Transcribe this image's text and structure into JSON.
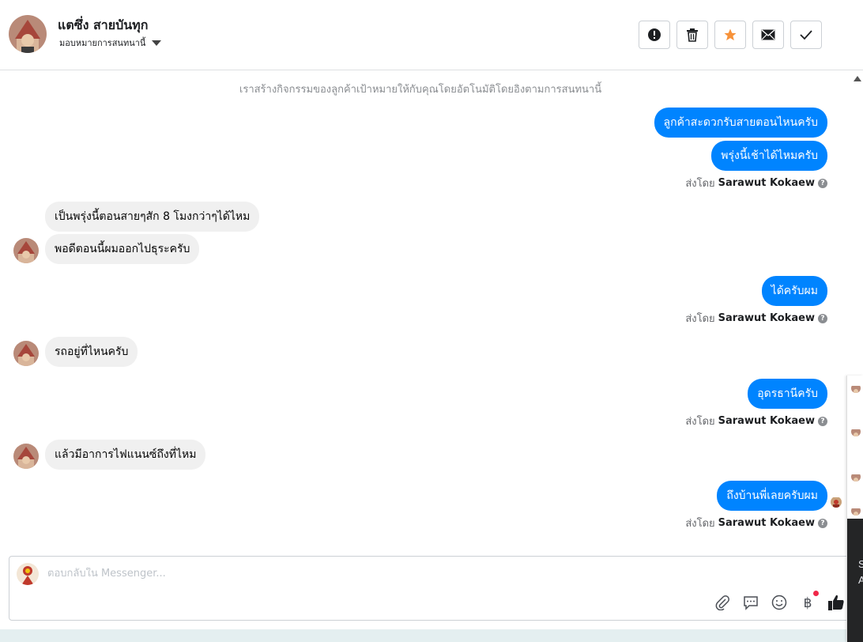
{
  "header": {
    "customer_name": "แตซึ่ง สายบันทุก",
    "assign_label": "มอบหมายการสนทนานี้",
    "icons": [
      "alert-icon",
      "trash-icon",
      "star-icon",
      "envelope-icon",
      "check-icon"
    ],
    "star_color": "#f7923a"
  },
  "chat": {
    "system_note": "เราสร้างกิจกรรมของลูกค้าเป้าหมายให้กับคุณโดยอัตโนมัติโดยอิงตามการสนทนานี้",
    "messages": [
      {
        "from": "page",
        "text": "ลูกค้าสะดวกรับสายตอนไหนครับ"
      },
      {
        "from": "page",
        "text": "พรุ่งนี้เช้าได้ไหมครับ"
      },
      {
        "from": "customer",
        "text": "เป็นพรุ่งนี้ตอนสายๆสัก 8 โมงกว่าๆได้ไหม"
      },
      {
        "from": "customer",
        "text": "พอดีตอนนี้ผมออกไปธุระครับ"
      },
      {
        "from": "page",
        "text": "ได้ครับผม"
      },
      {
        "from": "customer",
        "text": "รถอยู่ที่ไหนครับ"
      },
      {
        "from": "page",
        "text": "อุดรธานีครับ"
      },
      {
        "from": "customer",
        "text": "แล้วมีอาการไฟแนนซ์ถึงที่ไหม"
      },
      {
        "from": "page",
        "text": "ถึงบ้านพี่เลยครับผม"
      }
    ],
    "sent_by_prefix": "ส่งโดย",
    "sent_by_name": "Sarawut Kokaew",
    "page_bubble_color": "#0084ff",
    "customer_bubble_color": "#f0f0f0"
  },
  "composer": {
    "placeholder": "ตอบกลับใน Messenger...",
    "tools": [
      "paperclip-icon",
      "chat-bubble-icon",
      "emoji-icon",
      "baht-icon",
      "thumbs-up-icon"
    ]
  },
  "side_panel": {
    "line1": "S",
    "line2": "A"
  }
}
